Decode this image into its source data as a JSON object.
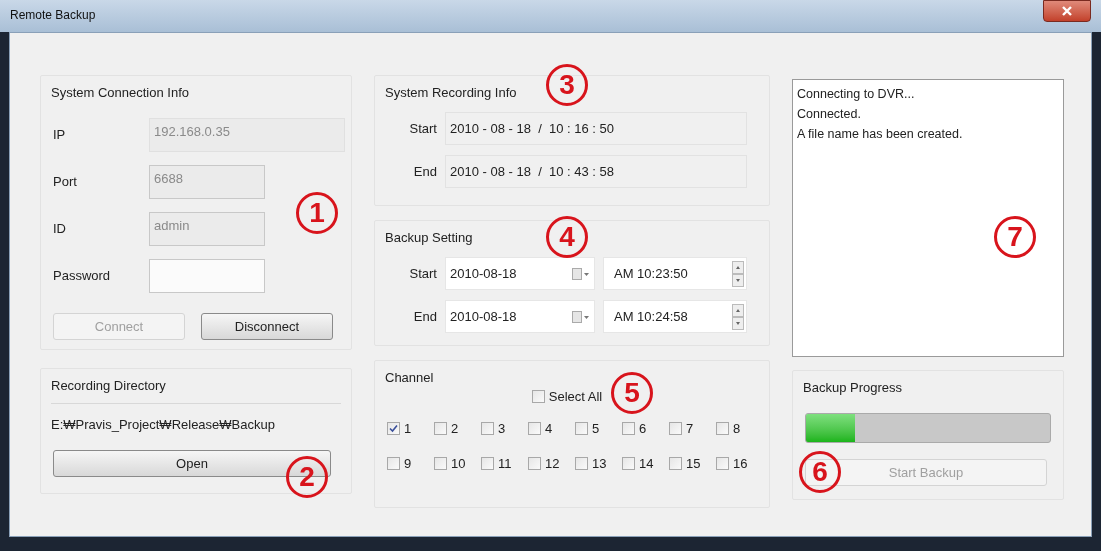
{
  "window": {
    "title": "Remote Backup"
  },
  "connection": {
    "title": "System Connection Info",
    "fields": [
      {
        "label": "IP",
        "value": "192.168.0.35",
        "disabled": true,
        "wide": true
      },
      {
        "label": "Port",
        "value": "6688",
        "disabled": true,
        "wide": false
      },
      {
        "label": "ID",
        "value": "admin",
        "disabled": true,
        "wide": false
      },
      {
        "label": "Password",
        "disabled": false,
        "wide": false
      }
    ],
    "buttons": [
      {
        "label": "Connect",
        "disabled": true
      },
      {
        "label": "Disconnect",
        "disabled": false
      }
    ]
  },
  "recording_directory": {
    "title": "Recording Directory",
    "path": "E:₩Pravis_Project₩Release₩Backup",
    "button": {
      "label": "Open",
      "disabled": false
    }
  },
  "system_recording_info": {
    "title": "System Recording Info",
    "rows": [
      {
        "label": "Start",
        "value": "2010 - 08 - 18  /  10 : 16 : 50"
      },
      {
        "label": "End",
        "value": "2010 - 08 - 18  /  10 : 43 : 58"
      }
    ]
  },
  "backup_setting": {
    "title": "Backup Setting",
    "rows": [
      {
        "label": "Start",
        "date": "2010-08-18",
        "time": "AM 10:23:50"
      },
      {
        "label": "End",
        "date": "2010-08-18",
        "time": "AM 10:24:58"
      }
    ]
  },
  "channel": {
    "title": "Channel",
    "select_all": {
      "label": "Select All",
      "checked": false
    },
    "channels": [
      {
        "label": "1",
        "checked": true
      },
      {
        "label": "2",
        "checked": false
      },
      {
        "label": "3",
        "checked": false
      },
      {
        "label": "4",
        "checked": false
      },
      {
        "label": "5",
        "checked": false
      },
      {
        "label": "6",
        "checked": false
      },
      {
        "label": "7",
        "checked": false
      },
      {
        "label": "8",
        "checked": false
      },
      {
        "label": "9",
        "checked": false
      },
      {
        "label": "10",
        "checked": false
      },
      {
        "label": "11",
        "checked": false
      },
      {
        "label": "12",
        "checked": false
      },
      {
        "label": "13",
        "checked": false
      },
      {
        "label": "14",
        "checked": false
      },
      {
        "label": "15",
        "checked": false
      },
      {
        "label": "16",
        "checked": false
      }
    ]
  },
  "log": {
    "lines": [
      "Connecting to DVR...",
      "Connected.",
      "A file name has been created."
    ]
  },
  "backup_progress": {
    "title": "Backup Progress",
    "level": 0.2,
    "button": {
      "label": "Start Backup",
      "disabled": true
    }
  },
  "callouts": [
    "1",
    "2",
    "3",
    "4",
    "5",
    "6",
    "7"
  ]
}
